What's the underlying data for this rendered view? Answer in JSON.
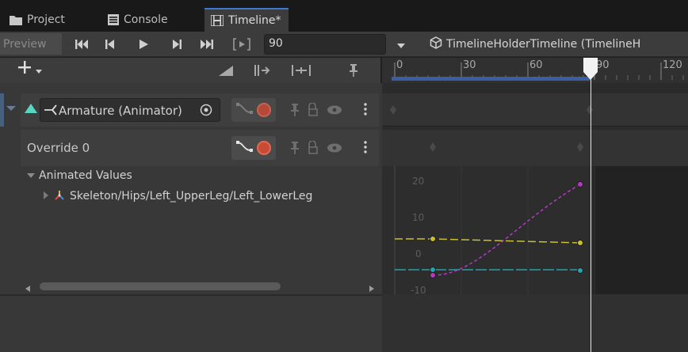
{
  "tabs": [
    {
      "label": "Project",
      "icon": "folder-icon"
    },
    {
      "label": "Console",
      "icon": "console-icon"
    },
    {
      "label": "Timeline*",
      "icon": "timeline-icon",
      "active": true
    }
  ],
  "toolbar": {
    "preview_label": "Preview",
    "frame_value": "90",
    "timeline_asset": "TimelineHolderTimeline (TimelineH"
  },
  "ruler": {
    "labels": [
      "0",
      "30",
      "60",
      "90",
      "120"
    ]
  },
  "tracks": [
    {
      "label": "Armature (Animator)"
    },
    {
      "label": "Override 0"
    }
  ],
  "curves": {
    "section_label": "Animated Values",
    "property_path": "Skeleton/Hips/Left_UpperLeg/Left_LowerLeg",
    "y_labels": [
      "20",
      "10",
      "0",
      "-10"
    ]
  },
  "colors": {
    "accent": "#3a78d3",
    "record": "#c94b36",
    "curve_magenta": "#b03cc0",
    "curve_yellow": "#c8c032",
    "curve_cyan": "#2aa0a8"
  }
}
